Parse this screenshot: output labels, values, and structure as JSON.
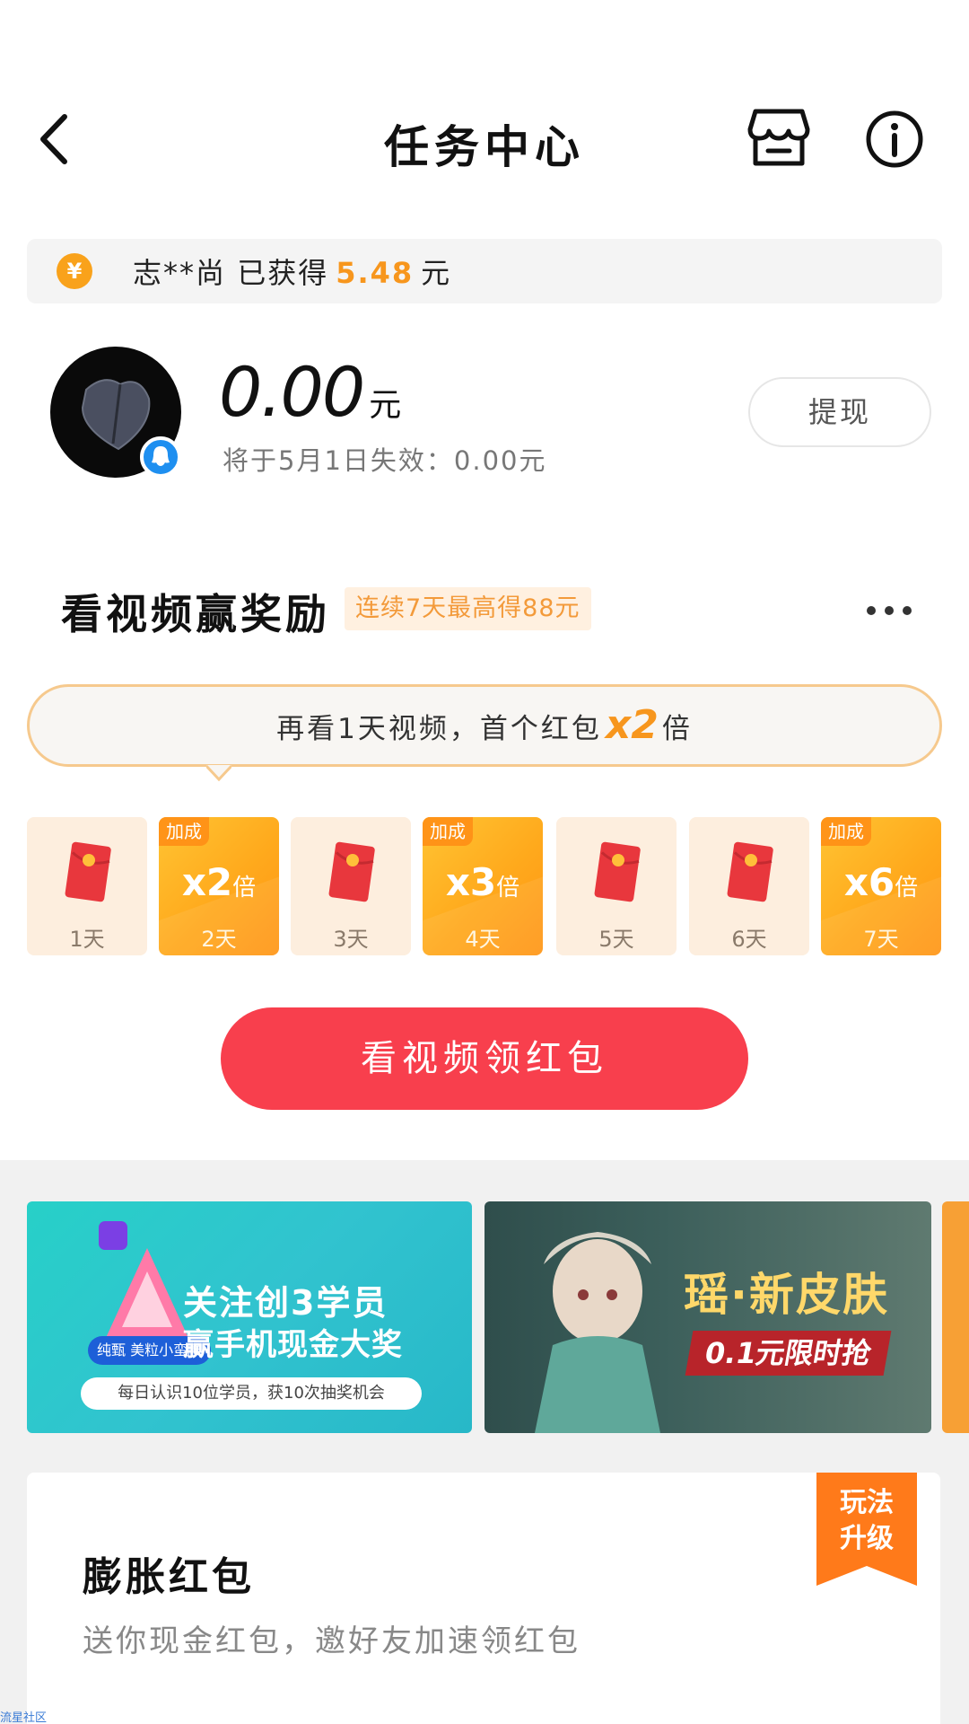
{
  "header": {
    "title": "任务中心",
    "back_icon": "chevron-left-icon",
    "store_icon": "store-icon",
    "info_icon": "info-icon"
  },
  "notice": {
    "name": "志**尚",
    "earned_label": "已获得",
    "amount": "5.48",
    "unit": "元"
  },
  "account": {
    "balance": "0.00",
    "unit": "元",
    "expire_text": "将于5月1日失效：0.00元",
    "withdraw_label": "提现"
  },
  "video_task": {
    "title": "看视频赢奖励",
    "tag": "连续7天最高得88元",
    "tip_prefix": "再看1天视频，首个红包",
    "tip_mult": "x2",
    "tip_suffix": "倍",
    "bonus_label": "加成",
    "days": [
      {
        "label": "1天",
        "bonus": false,
        "mult": ""
      },
      {
        "label": "2天",
        "bonus": true,
        "mult": "x2"
      },
      {
        "label": "3天",
        "bonus": false,
        "mult": ""
      },
      {
        "label": "4天",
        "bonus": true,
        "mult": "x3"
      },
      {
        "label": "5天",
        "bonus": false,
        "mult": ""
      },
      {
        "label": "6天",
        "bonus": false,
        "mult": ""
      },
      {
        "label": "7天",
        "bonus": true,
        "mult": "x6"
      }
    ],
    "mult_unit": "倍",
    "button_label": "看视频领红包"
  },
  "banners": [
    {
      "title": "关注创3学员",
      "subtitle": "赢手机现金大奖",
      "note": "每日认识10位学员，获10次抽奖机会",
      "brand": "纯甄 美粒小蛮腰"
    },
    {
      "title": "瑶·新皮肤",
      "subtitle": "0.1元限时抢"
    }
  ],
  "card": {
    "title": "膨胀红包",
    "desc": "送你现金红包，邀好友加速领红包",
    "ribbon_line1": "玩法",
    "ribbon_line2": "升级"
  },
  "watermark": "流星社区",
  "colors": {
    "accent_orange": "#f7961d",
    "primary_red": "#f83f4d",
    "qq_blue": "#1e8ff0"
  }
}
